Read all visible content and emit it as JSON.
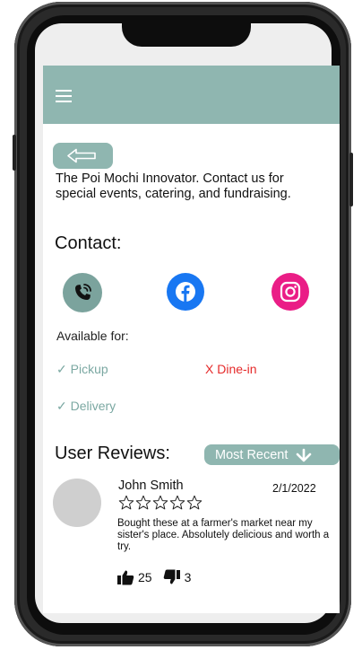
{
  "intro_text": "The Poi Mochi Innovator. Contact us for special events, catering, and fundraising.",
  "contact_heading": "Contact:",
  "available_label": "Available for:",
  "availability": {
    "pickup": "✓ Pickup",
    "dinein": "X Dine-in",
    "delivery": "✓ Delivery"
  },
  "reviews_heading": "User Reviews:",
  "sort_label": "Most Recent",
  "review": {
    "name": "John Smith",
    "date": "2/1/2022",
    "rating": 0,
    "max_rating": 5,
    "text": "Bought these at a farmer's market near my sister's place. Absolutely delicious and worth a try.",
    "likes": "25",
    "dislikes": "3"
  },
  "colors": {
    "accent": "#8fb6b0",
    "phone_icon_bg": "#7ba39d",
    "facebook": "#1877f2",
    "instagram": "#ea1d86",
    "available": "#7ba8a2",
    "unavailable": "#e52a2a"
  },
  "icons": [
    "hamburger-menu-icon",
    "back-arrow-icon",
    "phone-call-icon",
    "facebook-icon",
    "instagram-icon",
    "chevron-down-icon",
    "star-outline-icon",
    "thumbs-up-icon",
    "thumbs-down-icon"
  ]
}
